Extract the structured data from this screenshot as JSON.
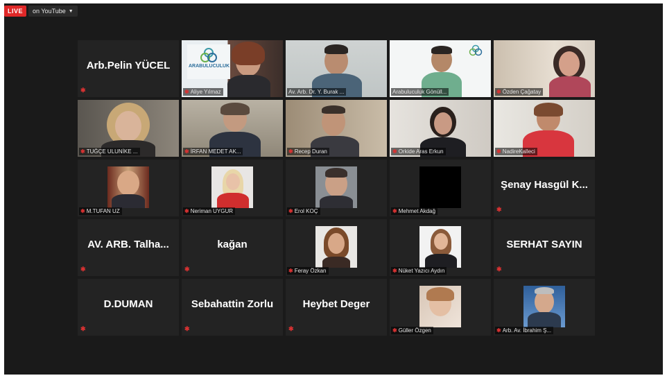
{
  "topbar": {
    "live": "LIVE",
    "youtube": "on YouTube"
  },
  "tiles": [
    {
      "name": "Arb.Pelin YÜCEL",
      "mode": "name"
    },
    {
      "name": "Aliye Yılmaz",
      "mode": "video"
    },
    {
      "name": "Av. Arb. Dr. Y. Burak ...",
      "mode": "video",
      "active": true
    },
    {
      "name": "Arabuluculuk Gönüll...",
      "mode": "video"
    },
    {
      "name": "Özden Çağatay",
      "mode": "video"
    },
    {
      "name": "TUĞÇE ULUNİKE ...",
      "mode": "video"
    },
    {
      "name": "İRFAN MEDET AK...",
      "mode": "video"
    },
    {
      "name": "Recep Duran",
      "mode": "video"
    },
    {
      "name": "Orkide Aras Erkun",
      "mode": "video"
    },
    {
      "name": "NadireKalleci",
      "mode": "video"
    },
    {
      "name": "M.TUFAN UZ",
      "mode": "photo"
    },
    {
      "name": "Neriman UYGUR",
      "mode": "photo"
    },
    {
      "name": "Erol KOÇ",
      "mode": "photo"
    },
    {
      "name": "Mehmet Akdağ",
      "mode": "photo"
    },
    {
      "name": "Şenay Hasgül K...",
      "mode": "name"
    },
    {
      "name": "AV. ARB. Talha...",
      "mode": "name"
    },
    {
      "name": "kağan",
      "mode": "name"
    },
    {
      "name": "Feray Özkan",
      "mode": "photo"
    },
    {
      "name": "Nüket Yazıcı Aydın",
      "mode": "photo"
    },
    {
      "name": "SERHAT SAYIN",
      "mode": "name"
    },
    {
      "name": "D.DUMAN",
      "mode": "name"
    },
    {
      "name": "Sebahattin Zorlu",
      "mode": "name"
    },
    {
      "name": "Heybet Deger",
      "mode": "name"
    },
    {
      "name": "Güller Özgen",
      "mode": "photo"
    },
    {
      "name": "Arb. Av. İbrahim Ş...",
      "mode": "photo"
    }
  ],
  "logo_text": "ARABULUCULUK",
  "colors": {
    "live": "#e02828",
    "active_border": "#b8d84e",
    "mic_muted": "#d83232"
  }
}
